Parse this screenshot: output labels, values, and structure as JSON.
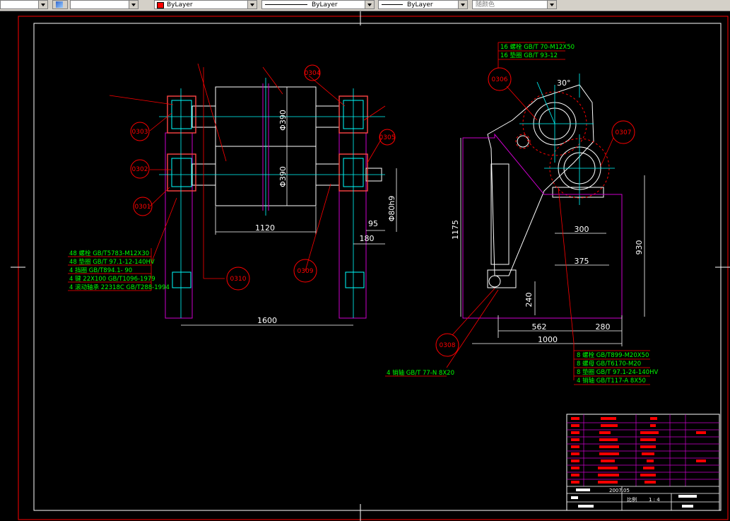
{
  "toolbar": {
    "color_label": "ByLayer",
    "linetype_label": "ByLayer",
    "lineweight_label": "ByLayer",
    "plotstyle_label": "随颜色"
  },
  "left_view": {
    "balloons": [
      "0303",
      "0302",
      "0301",
      "0304",
      "0305",
      "0310",
      "0309"
    ],
    "dimensions": {
      "d390_top": "Φ390",
      "d390_bot": "Φ390",
      "len1120": "1120",
      "len1600": "1600",
      "d95": "95",
      "d180": "180",
      "d80h9": "Φ80h9"
    },
    "parts_list": [
      "48 螺栓 GB/T5783-M12X30",
      "48 垫圈 GB/T 97.1-12-140HV",
      "4 挡圈 GB/T894.1- 90",
      "4 键 22X100 GB/T1096-1979",
      "4 滚动轴承 22318C GB/T288-1994"
    ]
  },
  "right_view": {
    "balloons": [
      "0306",
      "0307",
      "0308"
    ],
    "top_notes": [
      "16 螺栓 GB/T 70-M12X50",
      "16 垫圈 GB/T 93-12"
    ],
    "dimensions": {
      "angle": "30°",
      "d1175": "1175",
      "d300": "300",
      "d375": "375",
      "d930": "930",
      "d240": "240",
      "d562": "562",
      "d280": "280",
      "d1000": "1000"
    },
    "parts_list": [
      "8 螺栓 GB/T899-M20X50",
      "8 螺母 GB/T6170-M20",
      "8 垫圈 GB/T 97.1-24-140HV",
      "4 销轴 GB/T117-A 8X50"
    ],
    "bottom_note": "4 销轴 GB/T 77-N 8X20"
  },
  "title_block": {
    "scale_label": "比例",
    "scale_value": "1 : 4",
    "date_value": "2007.05"
  }
}
